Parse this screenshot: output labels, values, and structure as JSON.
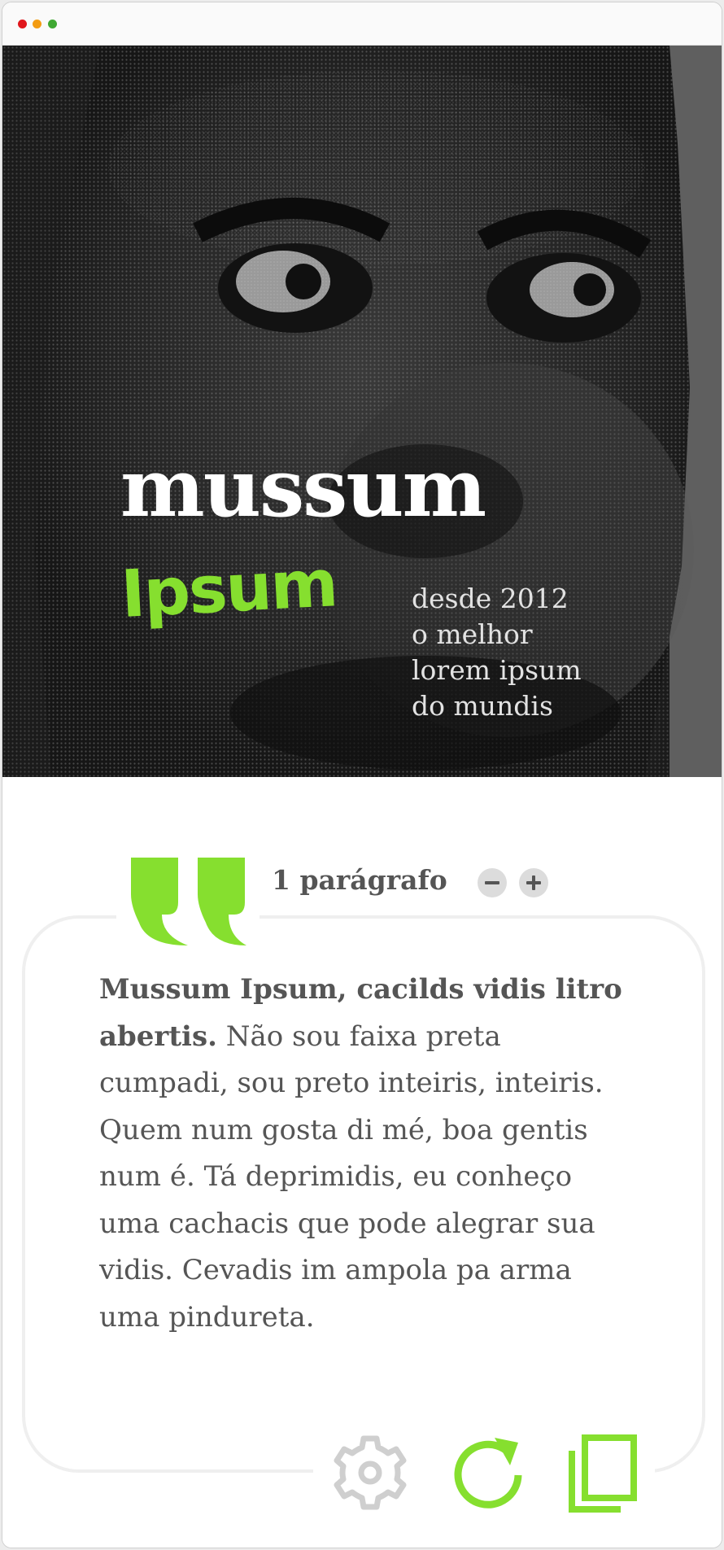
{
  "window": {
    "controls": [
      "close",
      "minimize",
      "maximize"
    ],
    "control_colors": {
      "close": "#e0171c",
      "minimize": "#f39c12",
      "maximize": "#3fa832"
    }
  },
  "hero": {
    "image": "halftone-face-portrait",
    "logo_line1": "mussum",
    "logo_line2": "Ipsum",
    "tagline": [
      "desde 2012",
      "o melhor",
      "lorem ipsum",
      "do mundis"
    ]
  },
  "generator": {
    "quote_icon": "quote-icon",
    "count_label": "1 parágrafo",
    "decrease_icon": "minus-icon",
    "increase_icon": "plus-icon",
    "paragraph_bold": "Mussum Ipsum, cacilds vidis litro abertis.",
    "paragraph_rest": " Não sou faixa preta cumpadi, sou preto inteiris, inteiris. Quem num gosta di mé, boa gentis num é. Tá deprimidis, eu conheço uma cachacis que pode alegrar sua vidis. Cevadis im ampola pa arma uma pindureta."
  },
  "toolbar": {
    "settings_icon": "gear-icon",
    "refresh_icon": "refresh-icon",
    "copy_icon": "copy-icon"
  },
  "colors": {
    "accent": "#86df2f",
    "text": "#555555",
    "muted_icon": "#cfcfcf",
    "hero_bg": "#1b1b1b"
  }
}
